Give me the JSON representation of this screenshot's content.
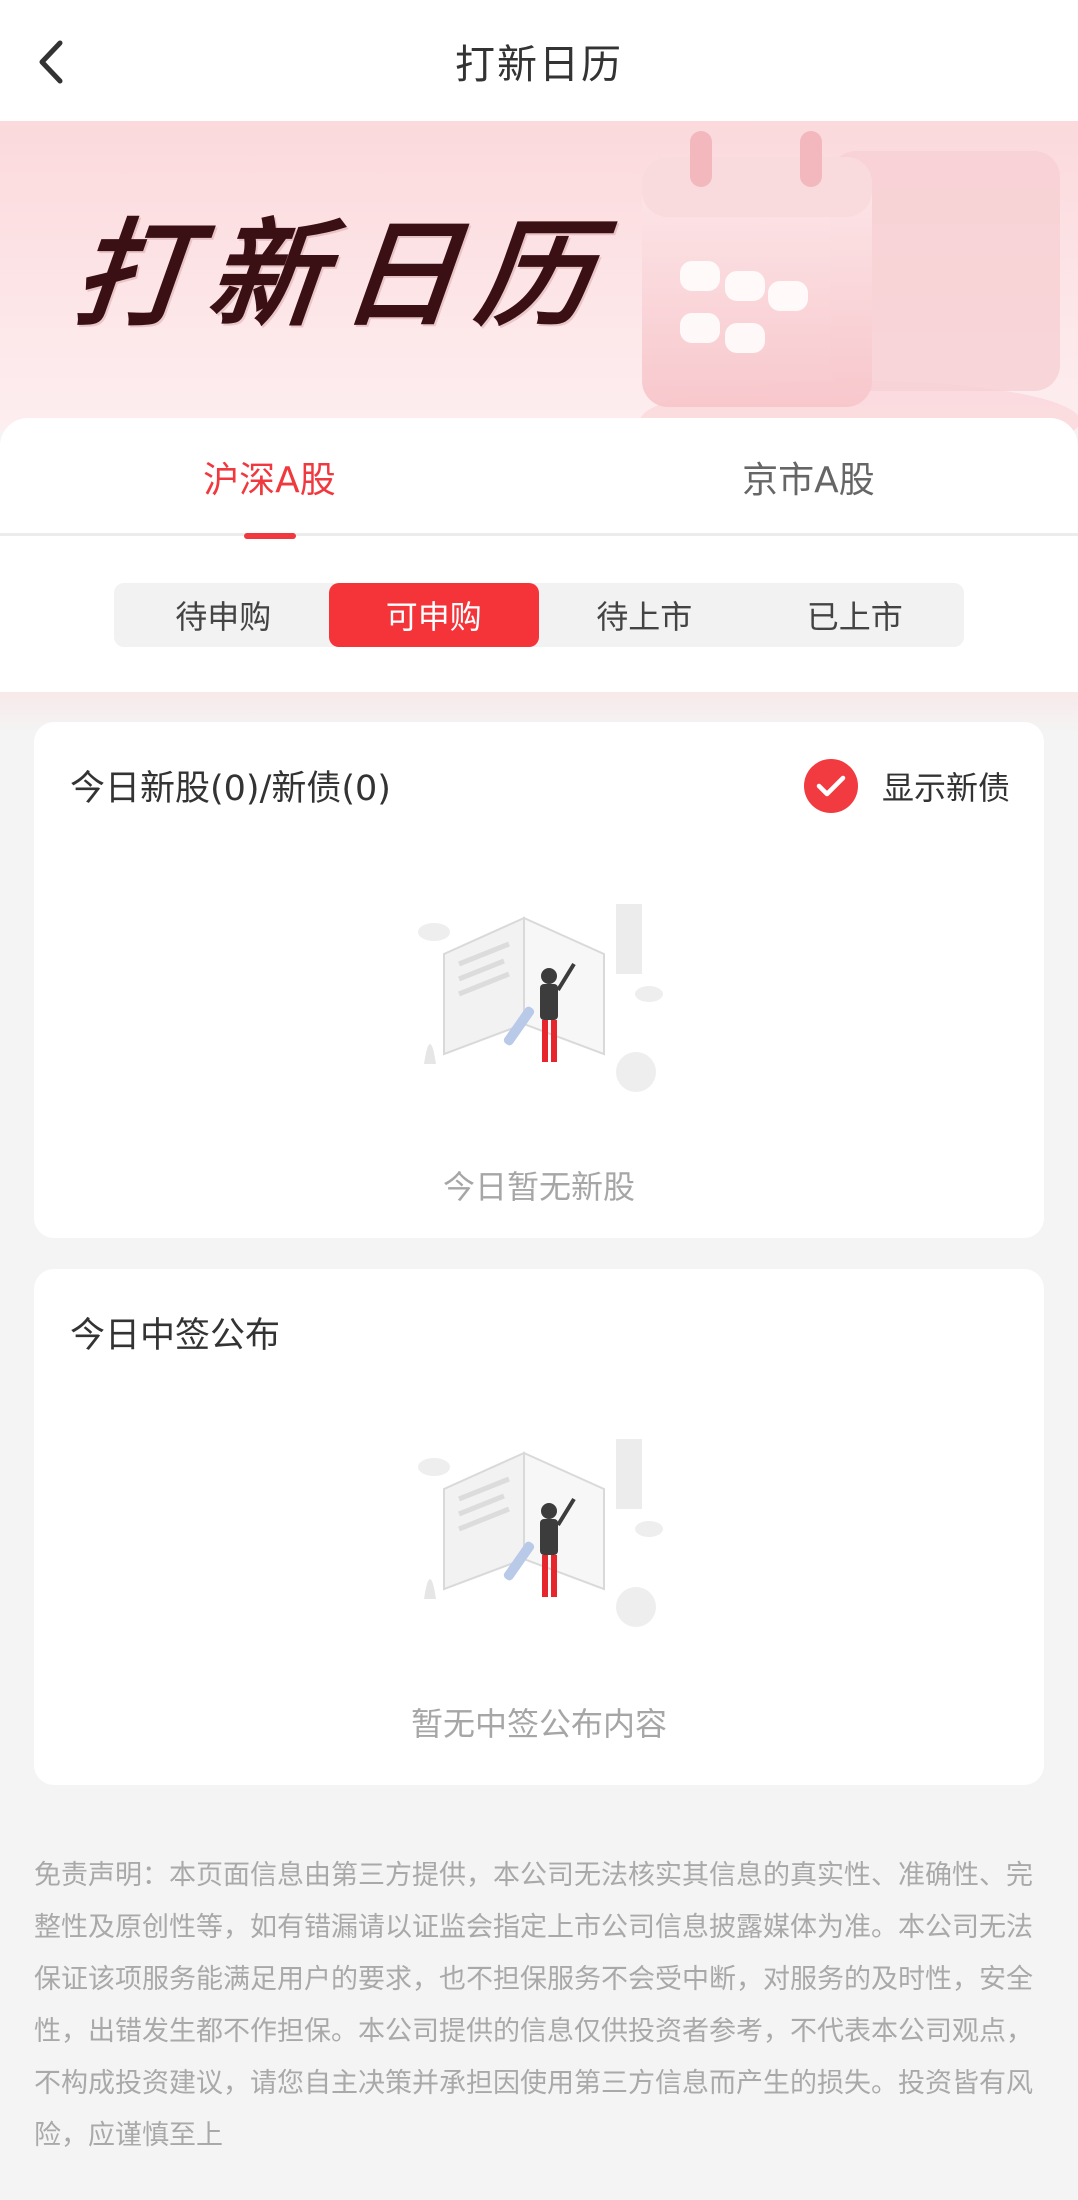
{
  "header": {
    "title": "打新日历",
    "back_icon": "chevron-left-icon"
  },
  "banner": {
    "title": "打新日历",
    "art_icon": "calendar-icon"
  },
  "market_tabs": [
    {
      "label": "沪深A股",
      "active": true
    },
    {
      "label": "京市A股",
      "active": false
    }
  ],
  "status_tabs": [
    {
      "label": "待申购",
      "active": false
    },
    {
      "label": "可申购",
      "active": true
    },
    {
      "label": "待上市",
      "active": false
    },
    {
      "label": "已上市",
      "active": false
    }
  ],
  "today_new": {
    "title": "今日新股(0)/新债(0)",
    "show_bonds_label": "显示新债",
    "show_bonds_checked": true,
    "empty_text": "今日暂无新股"
  },
  "today_lottery": {
    "title": "今日中签公布",
    "empty_text": "暂无中签公布内容"
  },
  "disclaimer": "免责声明：本页面信息由第三方提供，本公司无法核实其信息的真实性、准确性、完整性及原创性等，如有错漏请以证监会指定上市公司信息披露媒体为准。本公司无法保证该项服务能满足用户的要求，也不担保服务不会受中断，对服务的及时性，安全性，出错发生都不作担保。本公司提供的信息仅供投资者参考，不代表本公司观点，不构成投资建议，请您自主决策并承担因使用第三方信息而产生的损失。投资皆有风险，应谨慎至上",
  "colors": {
    "accent": "#f0393f",
    "banner_bg": "#fbd9dc",
    "page_bg": "#f4f4f4",
    "muted_text": "#a9a9a9"
  }
}
